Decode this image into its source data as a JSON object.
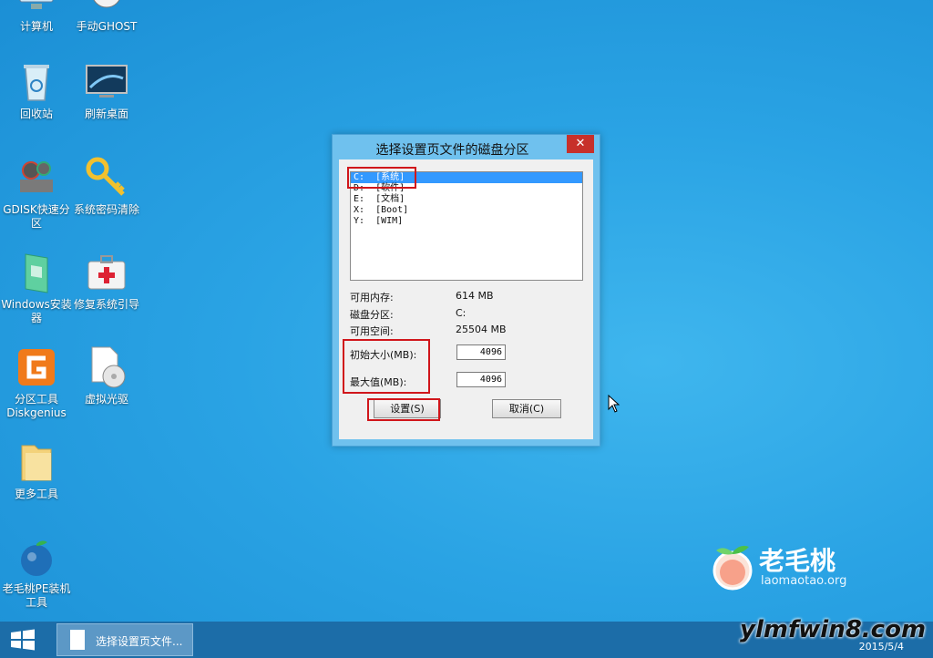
{
  "desktop": {
    "icons": [
      {
        "label": "计算机"
      },
      {
        "label": "手动GHOST"
      },
      {
        "label": "回收站"
      },
      {
        "label": "刷新桌面"
      },
      {
        "label": "GDISK快速分区"
      },
      {
        "label": "系统密码清除"
      },
      {
        "label": "Windows安装器"
      },
      {
        "label": "修复系统引导"
      },
      {
        "label": "分区工具Diskgenius"
      },
      {
        "label": "虚拟光驱"
      },
      {
        "label": "更多工具"
      },
      {
        "label": "老毛桃PE装机工具"
      }
    ],
    "brand": {
      "name": "老毛桃",
      "url": "laomaotao.org"
    }
  },
  "dialog": {
    "title": "选择设置页文件的磁盘分区",
    "close_label": "✕",
    "partitions": [
      "C:  [系统]",
      "D:  [软件]",
      "E:  [文档]",
      "X:  [Boot]",
      "Y:  [WIM]"
    ],
    "selected_index": 0,
    "info": {
      "memory_label": "可用内存:",
      "memory_value": "614 MB",
      "partition_label": "磁盘分区:",
      "partition_value": "C:",
      "space_label": "可用空间:",
      "space_value": "25504 MB"
    },
    "initial_size_label": "初始大小(MB):",
    "initial_size_value": "4096",
    "max_size_label": "最大值(MB):",
    "max_size_value": "4096",
    "set_button": "设置(S)",
    "cancel_button": "取消(C)"
  },
  "taskbar": {
    "task_label": "选择设置页文件...",
    "date": "2015/5/4"
  },
  "watermark": "ylmfwin8.com",
  "colors": {
    "highlight": "#d0161b",
    "selection": "#3399ff",
    "taskbar": "#1c6da8",
    "close": "#c7302a"
  }
}
